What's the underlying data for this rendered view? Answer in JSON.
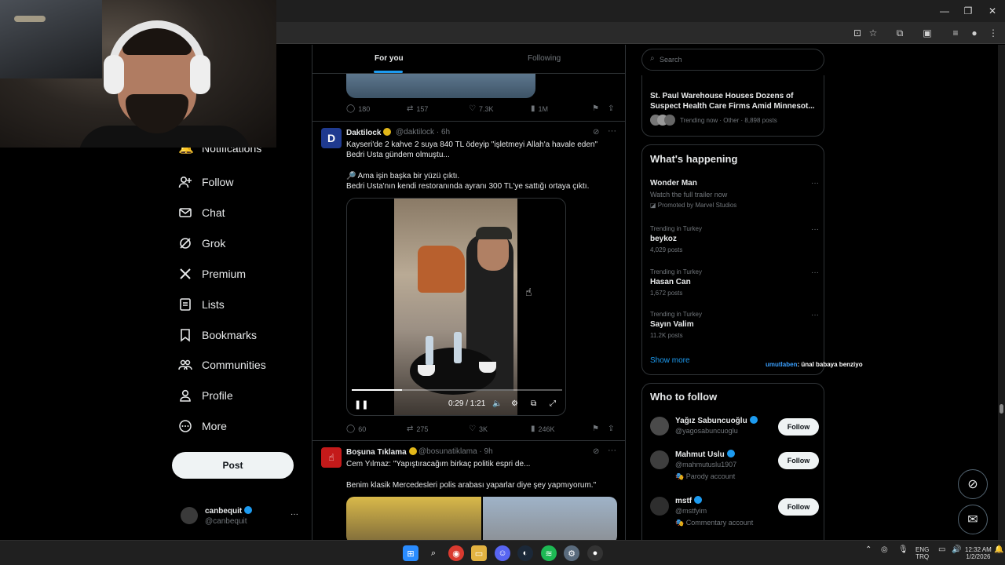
{
  "nav": {
    "items": [
      {
        "label": "Follow",
        "icon": "person-plus-icon"
      },
      {
        "label": "Chat",
        "icon": "mail-icon"
      },
      {
        "label": "Grok",
        "icon": "grok-icon"
      },
      {
        "label": "Premium",
        "icon": "x-logo-icon"
      },
      {
        "label": "Lists",
        "icon": "list-icon"
      },
      {
        "label": "Bookmarks",
        "icon": "bookmark-icon"
      },
      {
        "label": "Communities",
        "icon": "people-icon"
      },
      {
        "label": "Profile",
        "icon": "person-icon"
      },
      {
        "label": "More",
        "icon": "more-circle-icon"
      }
    ],
    "partial_hidden": "Notifications",
    "post_label": "Post"
  },
  "account": {
    "name": "canbequit",
    "handle": "@canbequit",
    "more": "···"
  },
  "timeline": {
    "tabs": [
      {
        "label": "For you"
      },
      {
        "label": "Following"
      }
    ],
    "prev_actions": {
      "replies": "180",
      "reposts": "157",
      "likes": "7.3K",
      "views": "1M"
    },
    "tweet1": {
      "name": "Daktilock",
      "handle_time": "@daktilock · 6h",
      "text": [
        "Kayseri'de 2 kahve 2 suya 840 TL ödeyip \"işletmeyi Allah'a havale eden\"",
        "Bedri Usta gündem olmuştu...",
        "",
        "🔎 Ama işin başka bir yüzü çıktı.",
        "Bedri Usta'nın kendi restoranında ayranı 300 TL'ye sattığı ortaya çıktı."
      ],
      "video": {
        "time": "0:29 / 1:21",
        "progress": 0.24
      },
      "actions": {
        "replies": "60",
        "reposts": "275",
        "likes": "3K",
        "views": "246K"
      }
    },
    "tweet2": {
      "name": "Boşuna Tıklama",
      "handle_time": "@bosunatiklama · 9h",
      "text": [
        "Cem Yılmaz: \"Yapıştıracağım birkaç politik espri de...",
        "",
        "Benim klasik Mercedesleri polis arabası yaparlar diye şey yapmıyorum.\""
      ]
    }
  },
  "right": {
    "search_placeholder": "Search",
    "news": {
      "title_line1": "St. Paul Warehouse Houses Dozens of",
      "title_line2": "Suspect Health Care Firms Amid Minnesot...",
      "meta": "Trending now · Other · 8,898 posts"
    },
    "happening": {
      "title": "What's happening",
      "trends": [
        {
          "top": "Wonder Man",
          "sub": "Watch the full trailer now",
          "promo": "Promoted by Marvel Studios"
        },
        {
          "top": "Trending in Turkey",
          "name": "beykoz",
          "count": "4,029 posts"
        },
        {
          "top": "Trending in Turkey",
          "name": "Hasan Can",
          "count": "1,672 posts"
        },
        {
          "top": "Trending in Turkey",
          "name": "Sayın Valim",
          "count": "11.2K posts"
        }
      ],
      "show_more": "Show more"
    },
    "who_to_follow": {
      "title": "Who to follow",
      "people": [
        {
          "name": "Yağız Sabuncuoğlu",
          "handle": "@yagosabuncuoglu",
          "label": "",
          "btn": "Follow"
        },
        {
          "name": "Mahmut Uslu",
          "handle": "@mahmutuslu1907",
          "label": "Parody account",
          "btn": "Follow"
        },
        {
          "name": "mstf",
          "handle": "@mstfyim",
          "label": "Commentary account",
          "btn": "Follow"
        }
      ]
    },
    "chat_overlay": {
      "user": "umutlaben",
      "message": ": ünal babaya benziyo"
    }
  },
  "taskbar": {
    "lang_top": "ENG",
    "lang_bottom": "TRQ",
    "time": "12:32 AM",
    "date": "1/2/2026"
  },
  "colors": {
    "accent": "#1d9bf0",
    "verified_gold": "#e2b719",
    "bg": "#000000"
  }
}
